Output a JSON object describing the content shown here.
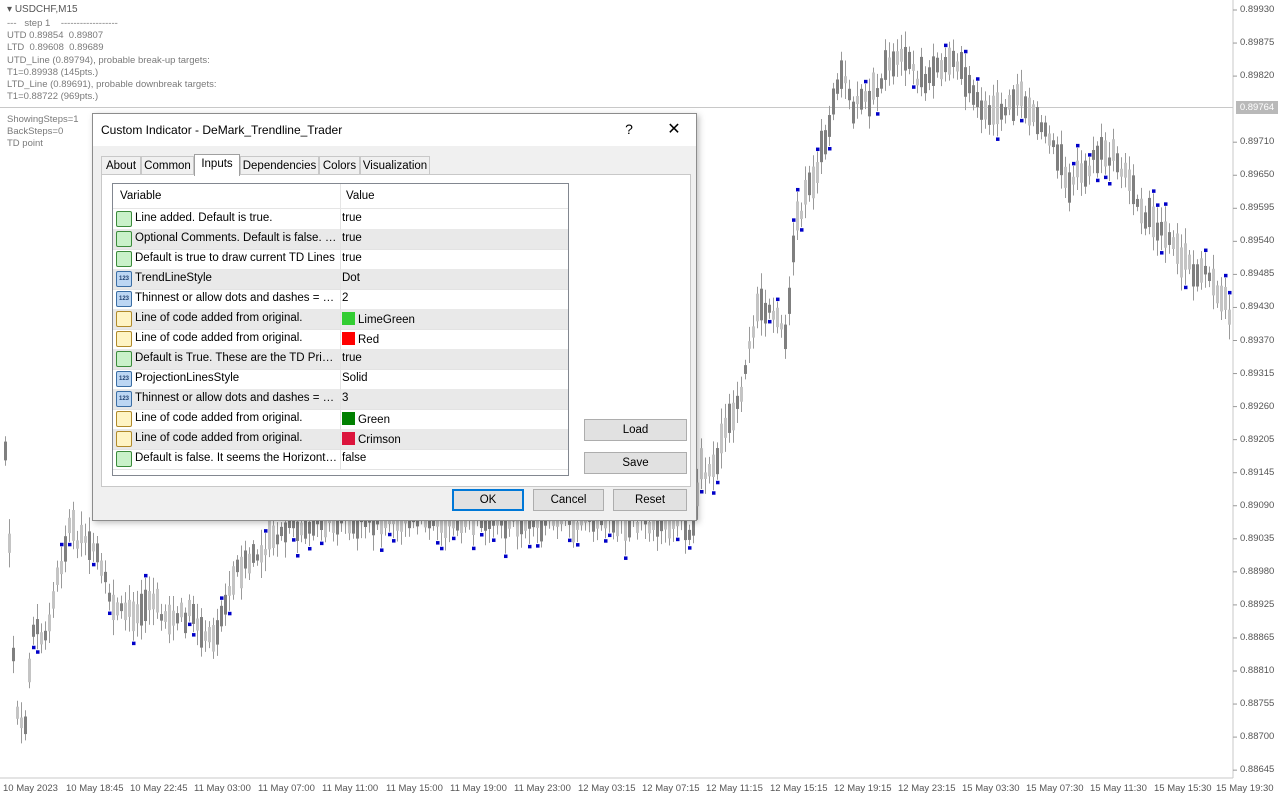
{
  "chart": {
    "symbol": "USDCHF,M15",
    "info_lines": [
      "---   step 1    ------------------",
      "UTD 0.89854  0.89807",
      "LTD  0.89608  0.89689",
      "UTD_Line (0.89794), probable break-up targets:",
      "T1=0.89938 (145pts.)",
      "LTD_Line (0.89691), probable downbreak targets:",
      "T1=0.88722 (969pts.)"
    ],
    "info_lines_2": [
      "ShowingSteps=1",
      "BackSteps=0",
      "TD point"
    ],
    "current_price": "0.89764",
    "price_labels": [
      "0.89930",
      "0.89875",
      "0.89820",
      "0.89764",
      "0.89710",
      "0.89650",
      "0.89595",
      "0.89540",
      "0.89485",
      "0.89430",
      "0.89370",
      "0.89315",
      "0.89260",
      "0.89205",
      "0.89145",
      "0.89090",
      "0.89035",
      "0.88980",
      "0.88925",
      "0.88865",
      "0.88810",
      "0.88755",
      "0.88700",
      "0.88645"
    ],
    "time_labels": [
      "10 May 2023",
      "10 May 18:45",
      "10 May 22:45",
      "11 May 03:00",
      "11 May 07:00",
      "11 May 11:00",
      "11 May 15:00",
      "11 May 19:00",
      "11 May 23:00",
      "12 May 03:15",
      "12 May 07:15",
      "12 May 11:15",
      "12 May 15:15",
      "12 May 19:15",
      "12 May 23:15",
      "15 May 03:30",
      "15 May 07:30",
      "15 May 11:30",
      "15 May 15:30",
      "15 May 19:30"
    ],
    "colors": {
      "candle": "#7f7f7f",
      "candle_wick": "#9a9a9a",
      "td_point": "#0000c8",
      "grid": "#e6e6e6"
    }
  },
  "dialog": {
    "title": "Custom Indicator - DeMark_Trendline_Trader",
    "help": "?",
    "close": "✕",
    "tabs": [
      "About",
      "Common",
      "Inputs",
      "Dependencies",
      "Colors",
      "Visualization"
    ],
    "active_tab": "Inputs",
    "grid": {
      "col_variable": "Variable",
      "col_value": "Value",
      "rows": [
        {
          "variable": "Line added.  Default is true.",
          "value": "true",
          "type": "bool"
        },
        {
          "variable": "Optional Comments.  Default is false. Org...",
          "value": "true",
          "type": "bool"
        },
        {
          "variable": "Default is true to draw current TD Lines",
          "value": "true",
          "type": "bool"
        },
        {
          "variable": "TrendLineStyle",
          "value": "Dot",
          "type": "int"
        },
        {
          "variable": "Thinnest or allow dots and dashes = 0 or...",
          "value": "2",
          "type": "int"
        },
        {
          "variable": "Line of code added from original.",
          "value": "LimeGreen",
          "type": "color",
          "swatch": "#32cd32"
        },
        {
          "variable": "Line of code added from original.",
          "value": "Red",
          "type": "color",
          "swatch": "#ff0000"
        },
        {
          "variable": "Default is True.  These are the TD Price ...",
          "value": "true",
          "type": "bool"
        },
        {
          "variable": "ProjectionLinesStyle",
          "value": "Solid",
          "type": "int"
        },
        {
          "variable": "Thinnest or allow dots and dashes = 0 or...",
          "value": "3",
          "type": "int"
        },
        {
          "variable": "Line of code added from original.",
          "value": "Green",
          "type": "color",
          "swatch": "#008000"
        },
        {
          "variable": "Line of code added from original.",
          "value": "Crimson",
          "type": "color",
          "swatch": "#dc143c"
        },
        {
          "variable": "Default is false.  It seems the Horizontal ...",
          "value": "false",
          "type": "bool"
        }
      ]
    },
    "buttons": {
      "load": "Load",
      "save": "Save",
      "ok": "OK",
      "cancel": "Cancel",
      "reset": "Reset"
    }
  }
}
